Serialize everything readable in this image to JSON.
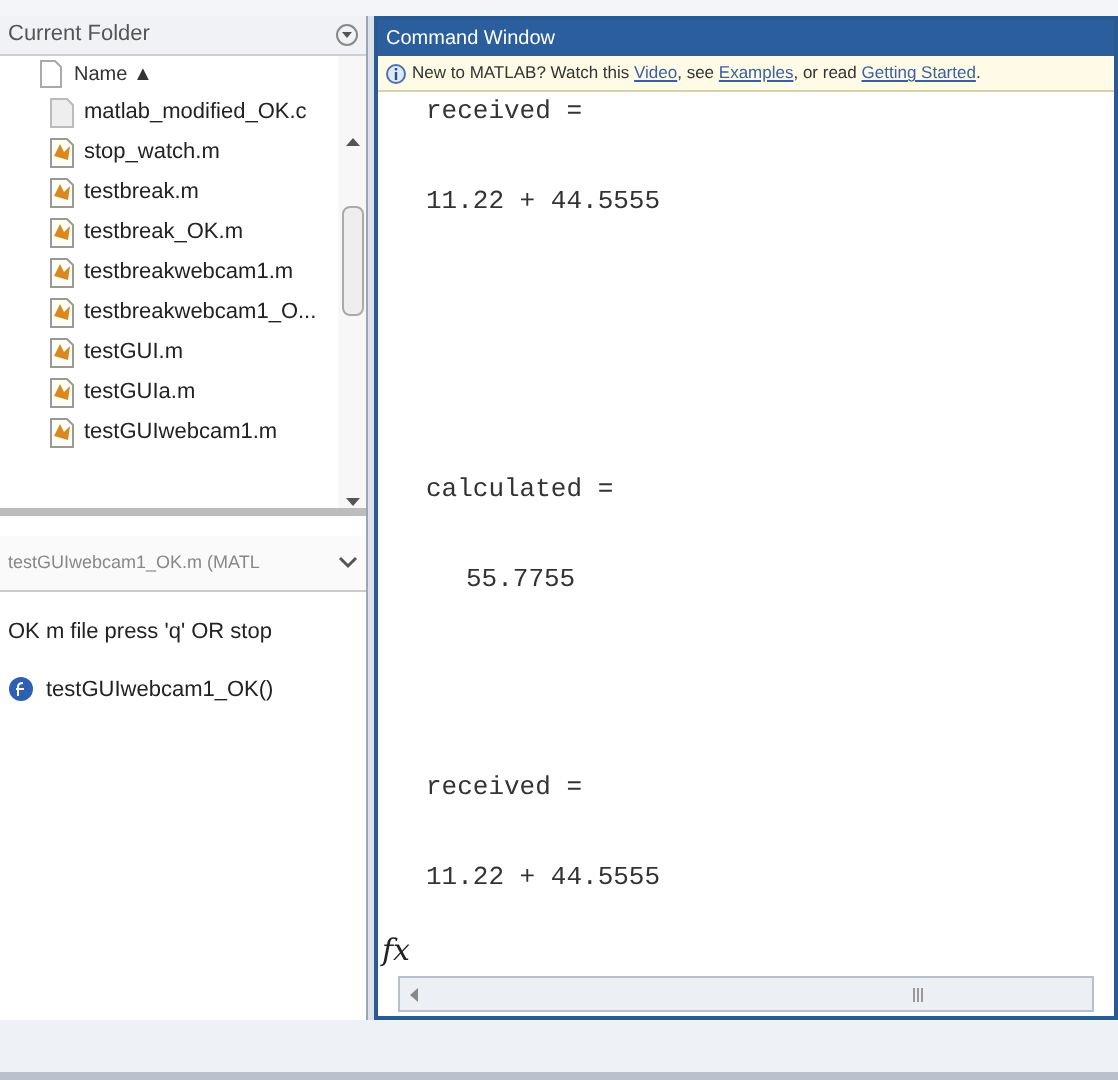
{
  "current_folder": {
    "title": "Current Folder",
    "column_header": "Name ▲",
    "files": [
      {
        "name": "matlab_modified_OK.c",
        "kind": "plain"
      },
      {
        "name": "stop_watch.m",
        "kind": "mfile"
      },
      {
        "name": "testbreak.m",
        "kind": "mfile"
      },
      {
        "name": "testbreak_OK.m",
        "kind": "mfile"
      },
      {
        "name": "testbreakwebcam1.m",
        "kind": "mfile"
      },
      {
        "name": "testbreakwebcam1_O...",
        "kind": "mfile"
      },
      {
        "name": "testGUI.m",
        "kind": "mfile"
      },
      {
        "name": "testGUIa.m",
        "kind": "mfile"
      },
      {
        "name": "testGUIwebcam1.m",
        "kind": "mfile"
      }
    ],
    "details_title": "testGUIwebcam1_OK.m (MATL",
    "details_description": "OK m file press 'q' OR stop",
    "details_function": "testGUIwebcam1_OK()"
  },
  "command_window": {
    "title": "Command Window",
    "info_bar": {
      "text": "New to MATLAB? Watch this ",
      "link1": "Video",
      "mid1": ", see ",
      "link2": "Examples",
      "mid2": ", or read ",
      "link3": "Getting Started",
      "end": "."
    },
    "lines": [
      {
        "text": "received =",
        "kind": "name"
      },
      {
        "text": "11.22 + 44.5555",
        "kind": "value"
      },
      {
        "text": "calculated =",
        "kind": "name"
      },
      {
        "text": "55.7755",
        "kind": "number"
      },
      {
        "text": "received =",
        "kind": "name"
      },
      {
        "text": "11.22 + 44.5555",
        "kind": "value"
      }
    ],
    "prompt": "fx"
  }
}
